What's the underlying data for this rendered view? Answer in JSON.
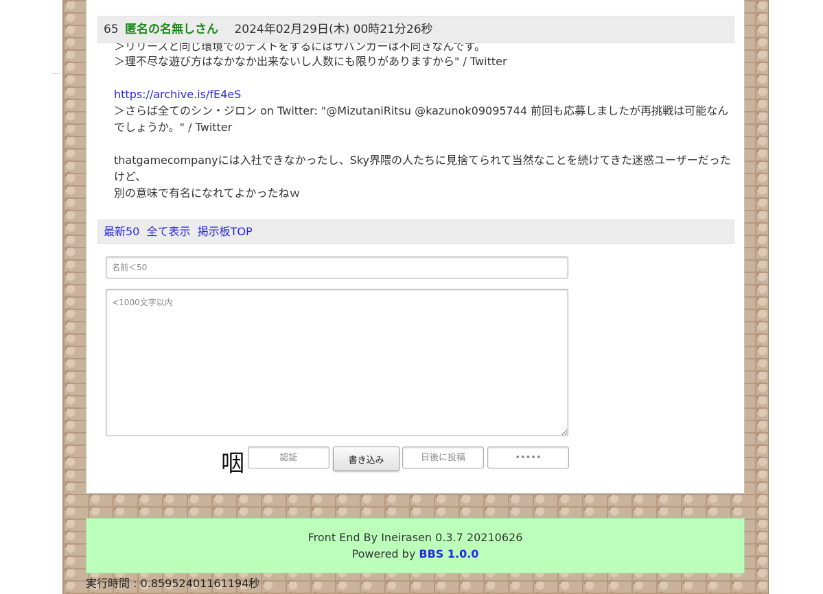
{
  "post": {
    "number": "65",
    "author": "匿名の名無しさん",
    "date": "2024年02月29日(木) 00時21分26秒",
    "clipped_line": "＞リリースと同じ環境でのテストをするにはサバンガーは不向きなんです。",
    "lines": {
      "l1": "＞理不尽な遊び方はなかなか出来ないし人数にも限りがありますから\" / Twitter",
      "link": "https://archive.is/fE4eS",
      "l2": "＞さらば全てのシン・ジロン on Twitter: \"@MizutaniRitsu @kazunok09095744 前回も応募しましたが再挑戦は可能なんでしょうか。\" / Twitter",
      "l3": "thatgamecompanyには入社できなかったし、Sky界隈の人たちに見捨てられて当然なことを続けてきた迷惑ユーザーだったけど、",
      "l4": "別の意味で有名になれてよかったねｗ"
    }
  },
  "nav": {
    "latest50": "最新50",
    "show_all": "全て表示",
    "board_top": "掲示板TOP"
  },
  "form": {
    "name_placeholder": "名前＜50",
    "message_placeholder": "<1000文字以内",
    "captcha_char": "咽",
    "auth_placeholder": "認証",
    "submit_label": "書き込み",
    "days_placeholder": "日後に投稿",
    "password_placeholder": "•••••"
  },
  "footer": {
    "front_end": "Front End By Ineirasen 0.3.7 20210626",
    "powered_by": "Powered by",
    "bbs_link": "BBS 1.0.0",
    "exec_time": "実行時間 : 0.85952401161194秒"
  },
  "side_mark": "＿"
}
